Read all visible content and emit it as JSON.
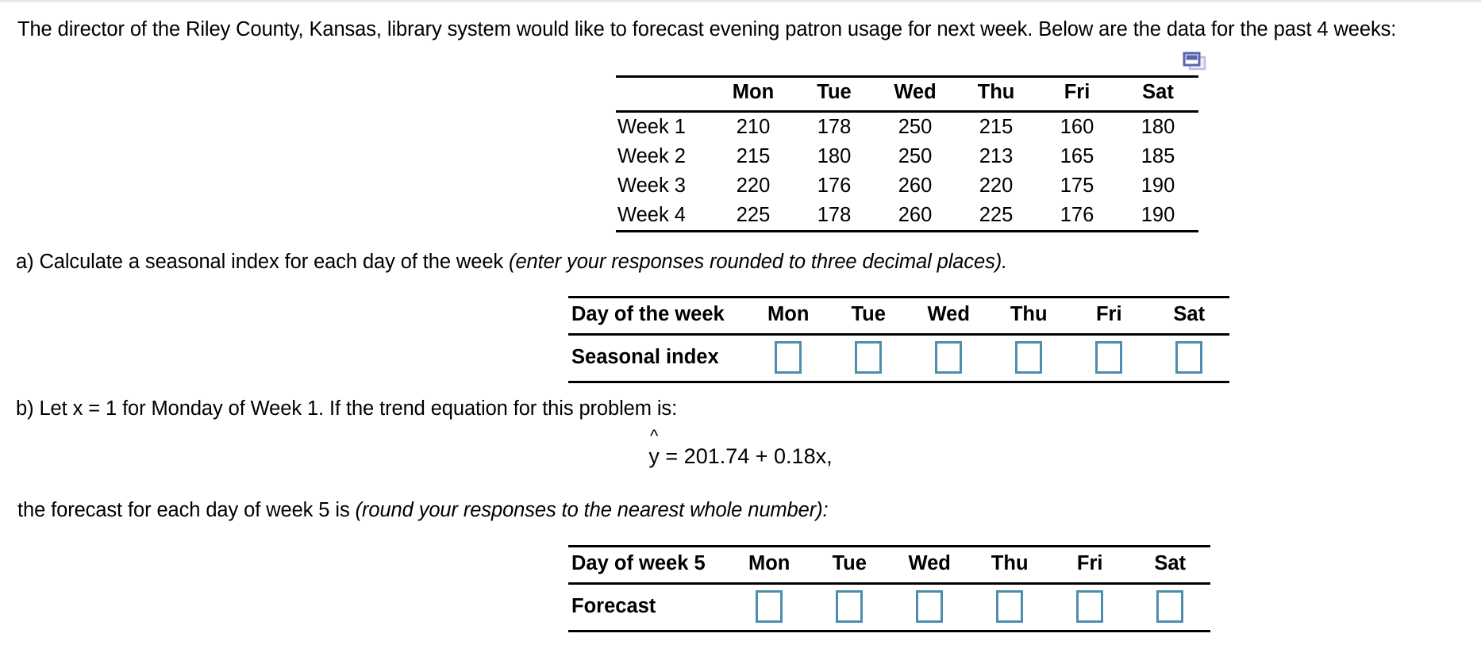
{
  "document": {
    "intro": "The director of the Riley County, Kansas, library system would like to forecast evening patron usage for next week. Below are the data for the past 4 weeks:",
    "part_a": {
      "text_plain": "a) Calculate a seasonal index for each day of the week ",
      "text_italic": "(enter your responses rounded to three decimal places)."
    },
    "part_b": {
      "text": "b) Let x = 1 for Monday of Week 1. If the trend equation for this problem is:"
    },
    "equation": {
      "hat": "^",
      "variable": "y",
      "body": " = 201.74 + 0.18x,"
    },
    "forecast_intro": {
      "text_plain": "the forecast for each day of week 5 is ",
      "text_italic": "(round your responses to the nearest whole number):"
    }
  },
  "icons": {
    "copy_window": "copy-window-icon",
    "copy_window_color": "#5a64ad",
    "copy_window_fill": "#dfe2f2"
  },
  "colors": {
    "input_border": "#4e8dae",
    "rule": "#000000",
    "page_background": "#ffffff",
    "top_edge": "#e6e8ec"
  },
  "weeks_table": {
    "corner_label": "",
    "columns": [
      "Mon",
      "Tue",
      "Wed",
      "Thu",
      "Fri",
      "Sat"
    ],
    "rows": [
      {
        "label": "Week 1",
        "values": [
          "210",
          "178",
          "250",
          "215",
          "160",
          "180"
        ]
      },
      {
        "label": "Week 2",
        "values": [
          "215",
          "180",
          "250",
          "213",
          "165",
          "185"
        ]
      },
      {
        "label": "Week 3",
        "values": [
          "220",
          "176",
          "260",
          "220",
          "175",
          "190"
        ]
      },
      {
        "label": "Week 4",
        "values": [
          "225",
          "178",
          "260",
          "225",
          "176",
          "190"
        ]
      }
    ]
  },
  "seasonal_table": {
    "header_label": "Day of the week",
    "columns": [
      "Mon",
      "Tue",
      "Wed",
      "Thu",
      "Fri",
      "Sat"
    ],
    "row_label": "Seasonal index",
    "values": [
      "",
      "",
      "",
      "",
      "",
      ""
    ],
    "placeholder": ""
  },
  "forecast_table": {
    "header_label": "Day of week 5",
    "columns": [
      "Mon",
      "Tue",
      "Wed",
      "Thu",
      "Fri",
      "Sat"
    ],
    "row_label": "Forecast",
    "values": [
      "",
      "",
      "",
      "",
      "",
      ""
    ],
    "placeholder": ""
  }
}
